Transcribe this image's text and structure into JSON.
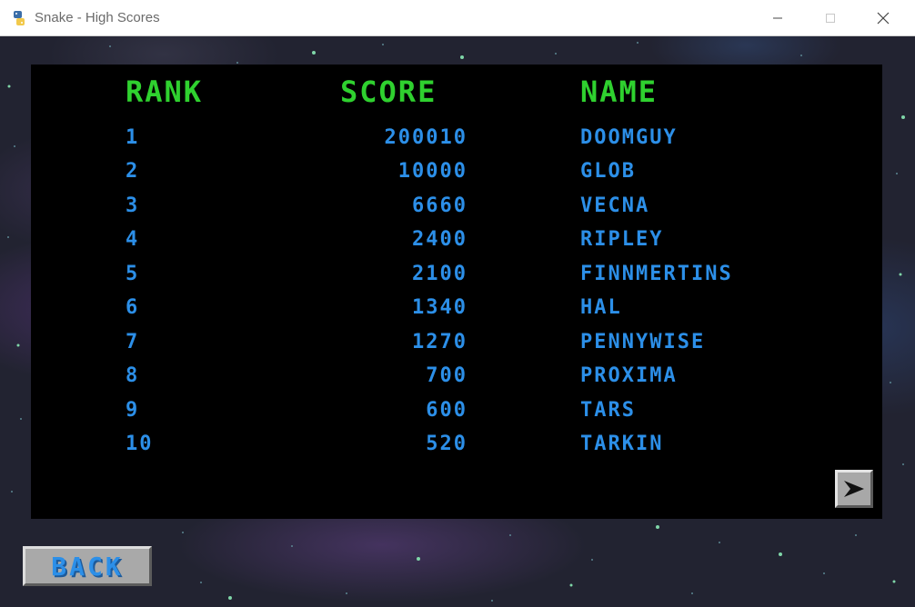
{
  "window": {
    "title": "Snake - High Scores",
    "icon": "python-icon"
  },
  "headers": {
    "rank": "RANK",
    "score": "SCORE",
    "name": "NAME"
  },
  "rows": [
    {
      "rank": "1",
      "score": "200010",
      "name": "DOOMGUY"
    },
    {
      "rank": "2",
      "score": "10000",
      "name": "GLOB"
    },
    {
      "rank": "3",
      "score": "6660",
      "name": "VECNA"
    },
    {
      "rank": "4",
      "score": "2400",
      "name": "RIPLEY"
    },
    {
      "rank": "5",
      "score": "2100",
      "name": "FINNMERTINS"
    },
    {
      "rank": "6",
      "score": "1340",
      "name": "HAL"
    },
    {
      "rank": "7",
      "score": "1270",
      "name": "PENNYWISE"
    },
    {
      "rank": "8",
      "score": "700",
      "name": "PROXIMA"
    },
    {
      "rank": "9",
      "score": "600",
      "name": "TARS"
    },
    {
      "rank": "10",
      "score": "520",
      "name": "TARKIN"
    }
  ],
  "buttons": {
    "back_label": "BACK",
    "next_icon": "arrow-right-icon"
  },
  "colors": {
    "header": "#2fd12f",
    "entry": "#2c8fe8",
    "panel": "#000000",
    "button": "#a9a9a9"
  }
}
